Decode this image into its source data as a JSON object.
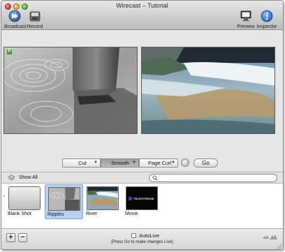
{
  "window": {
    "title": "Wirecast – Tutorial"
  },
  "toolbar": {
    "broadcast_label": "Broadcast",
    "record_label": "Record",
    "preview_label": "Preview",
    "inspector_label": "Inspector"
  },
  "monitors": {
    "left_badge": "P"
  },
  "transitions": {
    "cut_label": "Cut",
    "smooth_label": "Smooth",
    "pagecurl_label": "Page Curl",
    "go_label": "Go"
  },
  "shots_header": {
    "show_all_label": "Show All",
    "search_value": "",
    "search_placeholder": ""
  },
  "shots": [
    {
      "name": "Blank Shot"
    },
    {
      "name": "Ripples"
    },
    {
      "name": "River"
    },
    {
      "name": "Movie"
    }
  ],
  "movie_thumb_text": "TELESTREAM",
  "bottom": {
    "autolive_label": "AutoLive",
    "hint": "[Press Go to make changes Live]",
    "add": "+",
    "remove": "−"
  },
  "colors": {
    "selection": "#b9d3ee",
    "badge": "#3ea12f",
    "inspector_accent": "#2d6fd2"
  }
}
